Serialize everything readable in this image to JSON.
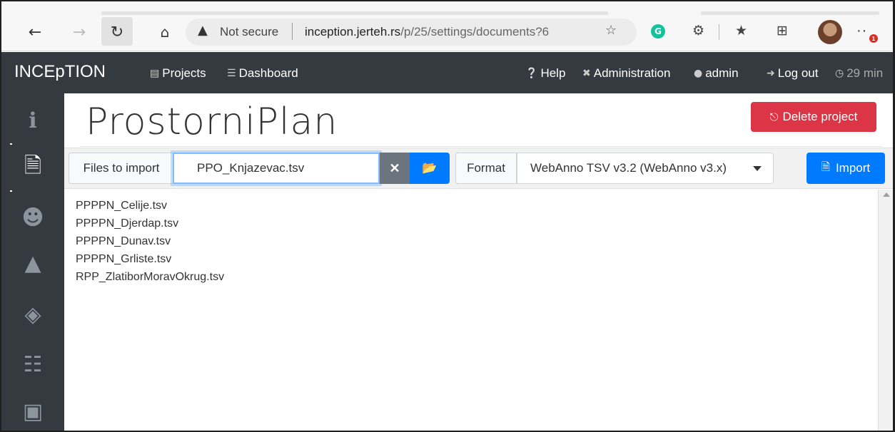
{
  "browser": {
    "url_warning": "Not secure",
    "url_host": "inception.jerteh.rs",
    "url_path": "/p/25/settings/documents?6",
    "extension_g": "G",
    "more_badge": "1"
  },
  "navbar": {
    "brand": "INCEpTION",
    "projects": "Projects",
    "dashboard": "Dashboard",
    "help": "Help",
    "administration": "Administration",
    "user": "admin",
    "logout": "Log out",
    "session": "29 min"
  },
  "page": {
    "title": "ProstorniPlan",
    "delete_label": "Delete project"
  },
  "import": {
    "files_label": "Files to import",
    "files_value": "PPO_Knjazevac.tsv",
    "format_label": "Format",
    "format_value": "WebAnno TSV v3.2 (WebAnno v3.x)",
    "import_label": "Import"
  },
  "documents": [
    "PPPPN_Celije.tsv",
    "PPPPN_Djerdap.tsv",
    "PPPPN_Dunav.tsv",
    "PPPPN_Grliste.tsv",
    "RPP_ZlatiborMoravOkrug.tsv"
  ],
  "icons": {
    "sidebar": [
      "info-icon",
      "document-icon",
      "users-icon",
      "constraints-icon",
      "layers-icon",
      "hierarchy-icon",
      "robot-icon"
    ]
  },
  "colors": {
    "navbar": "#343a40",
    "danger": "#dc3545",
    "primary": "#007bff",
    "secondary": "#6c757d"
  }
}
